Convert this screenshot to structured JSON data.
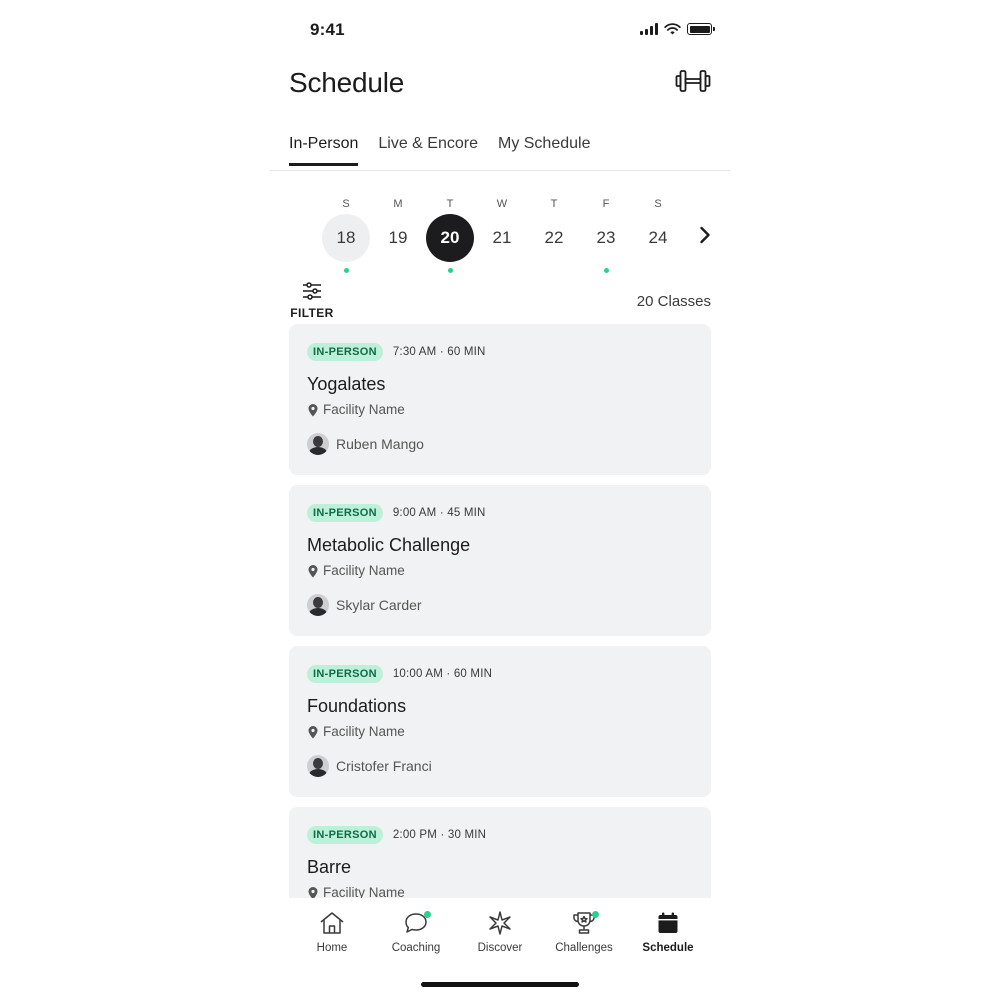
{
  "status_bar": {
    "time": "9:41"
  },
  "header": {
    "title": "Schedule",
    "equipment_icon": "dumbbell-icon"
  },
  "tabs": [
    {
      "label": "In-Person",
      "active": true
    },
    {
      "label": "Live & Encore",
      "active": false
    },
    {
      "label": "My Schedule",
      "active": false
    }
  ],
  "week": {
    "days": [
      {
        "letter": "S",
        "number": "18",
        "state": "today",
        "has_classes": true
      },
      {
        "letter": "M",
        "number": "19",
        "state": "",
        "has_classes": false
      },
      {
        "letter": "T",
        "number": "20",
        "state": "selected",
        "has_classes": true
      },
      {
        "letter": "W",
        "number": "21",
        "state": "",
        "has_classes": false
      },
      {
        "letter": "T",
        "number": "22",
        "state": "",
        "has_classes": false
      },
      {
        "letter": "F",
        "number": "23",
        "state": "",
        "has_classes": true
      },
      {
        "letter": "S",
        "number": "24",
        "state": "",
        "has_classes": false
      }
    ],
    "next_icon": "chevron-right-icon"
  },
  "filter": {
    "label": "FILTER",
    "icon": "sliders-icon"
  },
  "class_count": "20 Classes",
  "classes": [
    {
      "badge": "IN-PERSON",
      "time": "7:30 AM · 60 MIN",
      "title": "Yogalates",
      "facility": "Facility Name",
      "instructor": "Ruben Mango"
    },
    {
      "badge": "IN-PERSON",
      "time": "9:00 AM · 45 MIN",
      "title": "Metabolic Challenge",
      "facility": "Facility Name",
      "instructor": "Skylar Carder"
    },
    {
      "badge": "IN-PERSON",
      "time": "10:00 AM · 60 MIN",
      "title": "Foundations",
      "facility": "Facility Name",
      "instructor": "Cristofer Franci"
    },
    {
      "badge": "IN-PERSON",
      "time": "2:00 PM · 30 MIN",
      "title": "Barre",
      "facility": "Facility Name",
      "instructor": ""
    }
  ],
  "bottom_nav": [
    {
      "label": "Home",
      "icon": "home-icon",
      "active": false,
      "dot": false
    },
    {
      "label": "Coaching",
      "icon": "chat-bubble-icon",
      "active": false,
      "dot": true
    },
    {
      "label": "Discover",
      "icon": "sparkle-icon",
      "active": false,
      "dot": false
    },
    {
      "label": "Challenges",
      "icon": "trophy-icon",
      "active": false,
      "dot": true
    },
    {
      "label": "Schedule",
      "icon": "calendar-icon",
      "active": true,
      "dot": false
    }
  ],
  "colors": {
    "accent_green": "#2ccf8f",
    "badge_bg": "#bdf0d9",
    "badge_text": "#0f6b4a",
    "card_bg": "#f1f2f3",
    "selected_day": "#1c1c1e"
  }
}
